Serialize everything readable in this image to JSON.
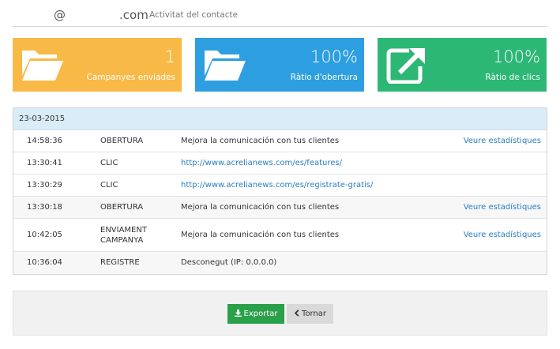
{
  "header": {
    "at": "@",
    "domain": ".com",
    "subtitle": "Activitat del contacte"
  },
  "stats": [
    {
      "value": "1",
      "label": "Campanyes enviades",
      "icon": "folder-icon",
      "color": "#f9b947"
    },
    {
      "value": "100%",
      "label": "Ràtio d'obertura",
      "icon": "folder-icon",
      "color": "#2d9fe0"
    },
    {
      "value": "100%",
      "label": "Ràtio de clics",
      "icon": "external-link-icon",
      "color": "#2db775"
    }
  ],
  "activity": {
    "date": "23-03-2015",
    "rows": [
      {
        "time": "14:58:36",
        "type": "OBERTURA",
        "description": "Mejora la comunicación con tus clientes",
        "action": "Veure estadístiques"
      },
      {
        "time": "13:30:41",
        "type": "CLIC",
        "description": "http://www.acrelianews.com/es/features/",
        "action": ""
      },
      {
        "time": "13:30:29",
        "type": "CLIC",
        "description": "http://www.acrelianews.com/es/registrate-gratis/",
        "action": ""
      },
      {
        "time": "13:30:18",
        "type": "OBERTURA",
        "description": "Mejora la comunicación con tus clientes",
        "action": "Veure estadístiques"
      },
      {
        "time": "10:42:05",
        "type": "ENVIAMENT CAMPANYA",
        "description": "Mejora la comunicación con tus clientes",
        "action": "Veure estadístiques"
      },
      {
        "time": "10:36:04",
        "type": "REGISTRE",
        "description": "Desconegut (IP: 0.0.0.0)",
        "action": ""
      }
    ]
  },
  "footer": {
    "export_label": "Exportar",
    "back_label": "Tornar"
  }
}
